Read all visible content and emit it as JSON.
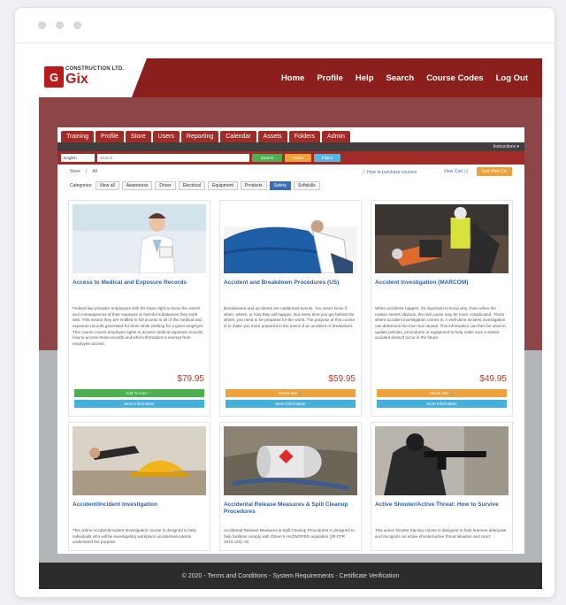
{
  "logo": {
    "top_text": "CONSTRUCTION LTD.",
    "name": "Gix",
    "badge": "G"
  },
  "nav": [
    "Home",
    "Profile",
    "Help",
    "Search",
    "Course Codes",
    "Log Out"
  ],
  "tabs": [
    "Training",
    "Profile",
    "Store",
    "Users",
    "Reporting",
    "Calendar",
    "Assets",
    "Folders",
    "Admin"
  ],
  "instructions_label": "Instructions ▾",
  "search": {
    "language": "English",
    "placeholder": "Search",
    "search_btn": "Search",
    "reset_btn": "Reset",
    "filters_btn": "Filters"
  },
  "crumbs": {
    "store": "Store",
    "sep": "/",
    "all": "All",
    "how": "How to purchase courses",
    "cart": "View Cart",
    "view_btn": "Exit View Co"
  },
  "categories_label": "Categories:",
  "categories": [
    "View all",
    "Awareness",
    "Driver",
    "Electrical",
    "Equipment",
    "Products",
    "Safety",
    "Softskills"
  ],
  "active_category": "Safety",
  "cards": [
    {
      "title": "Access to Medical and Exposure Records",
      "desc": "Federal law provides employees with the basic right to know the extent and consequences of their exposure to harmful substances they work with. This means they are entitled to full access to all of the medical and exposure records generated for them while working for a given employer. This course covers employee rights to access medical exposure records, how to access those records and what information is exempt from employee access.",
      "price": "$79.95",
      "btn1": "Add To Cart 🛒",
      "btn2": "More Information"
    },
    {
      "title": "Accident and Breakdown Procedures (US)",
      "desc": "Breakdowns and accidents are unplanned events. You never know if, when, where, or how they will happen. But every time you get behind the wheel, you need to be prepared for the worst. The purpose of this course is to make you more prepared in the event of an accident or breakdown.",
      "price": "$59.95",
      "btn1": "Check Out 🛒",
      "btn2": "More Information"
    },
    {
      "title": "Accident Investigation (MARCOM)",
      "desc": "When accidents happen, it's important to know why. Even when the reason seems obvious, the real cause may be more complicated. That's where accident investigation comes in. A well-done incident investigation can determine the true root causes. This information can then be used to update policies, procedures or equipment to help make sure a similar accident doesn't occur in the future.",
      "price": "$49.95",
      "btn1": "Check Out 🛒",
      "btn2": "More Information"
    },
    {
      "title": "Accident/Incident Investigation",
      "desc": "This online Accident/Incident Investigation course is designed to help individuals who will be investigating workplace accidents/incidents understand the purpose",
      "price": "",
      "btn1": "",
      "btn2": ""
    },
    {
      "title": "Accidental Release Measures & Spill Cleanup Procedures",
      "desc": "Accidental Release Measures & Spill Cleanup Procedures is designed to help facilities comply with OSHA's HAZWOPER regulation (29 CFR 1910.120). As",
      "price": "",
      "btn1": "",
      "btn2": ""
    },
    {
      "title": "Active Shooter/Active Threat: How to Survive",
      "desc": "This active shooter training course is designed to help learners anticipate and recognize an active shooter/active threat situation and react",
      "price": "",
      "btn1": "",
      "btn2": ""
    }
  ],
  "footer": "© 2020 - Terms and Conditions - System Requirements - Certificate Verification"
}
